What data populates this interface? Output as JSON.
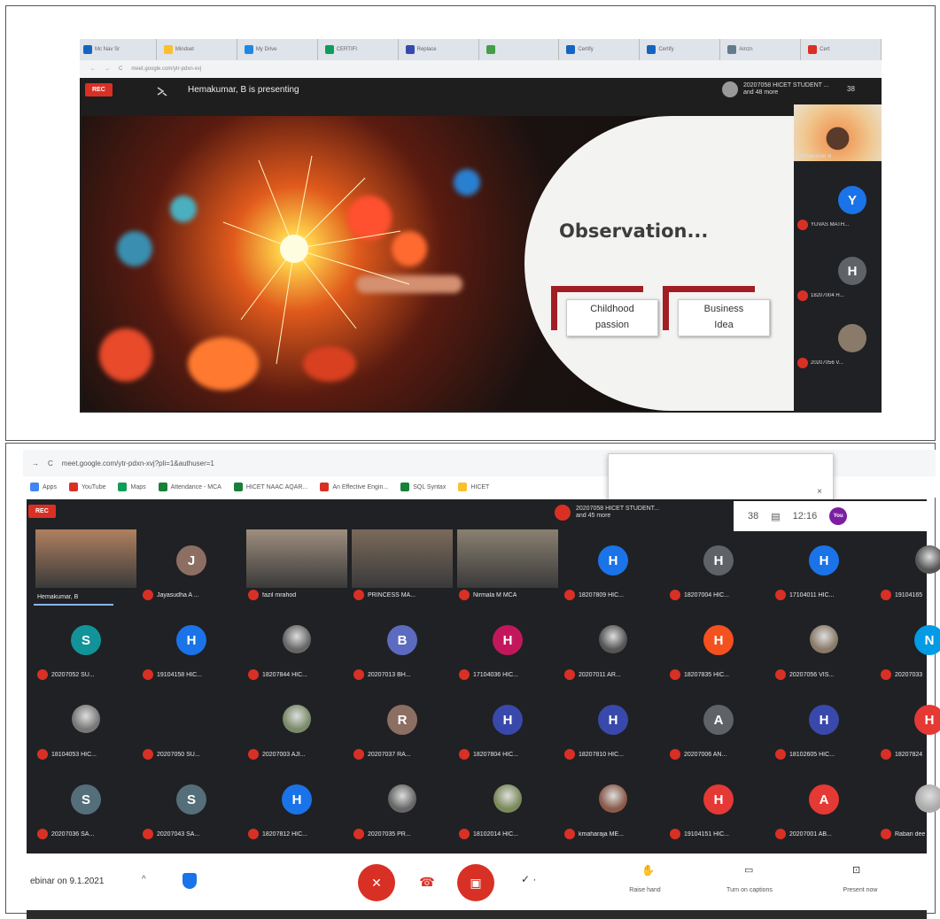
{
  "screen1": {
    "tabs": [
      "Mc Nav Sr",
      "Mindset",
      "My Drive",
      "CERTIFI",
      "Replace",
      "",
      "Certify",
      "Certify",
      "Amzn",
      "Cert"
    ],
    "url": "meet.google.com/ytr-pdxn-xvj",
    "rec_label": "REC",
    "presenting_text": "Hemakumar, B is presenting",
    "participants_line1": "20207058 HICET STUDENT ...",
    "participants_line2": "and 48 more",
    "people_count": "38",
    "slide": {
      "title": "Observation...",
      "box1": "Childhood\npassion",
      "box2": "Business\nIdea"
    },
    "side_tiles": [
      {
        "name": "Hemakumar B",
        "initial": "",
        "color": "#c0a080"
      },
      {
        "name": "YUVAS MATH...",
        "initial": "Y",
        "color": "#1a73e8"
      },
      {
        "name": "18207004 H...",
        "initial": "H",
        "color": "#5f6368"
      },
      {
        "name": "20207056 V...",
        "initial": "",
        "color": "#8a7a6a"
      }
    ]
  },
  "screen2": {
    "url": "meet.google.com/ytr-pdxn-xvj?pli=1&authuser=1",
    "bookmarks": [
      "Apps",
      "YouTube",
      "Maps",
      "Attendance - MCA",
      "HICET NAAC AQAR...",
      "An Effective Engin...",
      "SQL Syntax",
      "HICET"
    ],
    "header_participants_line1": "20207058 HICET STUDENT...",
    "header_participants_line2": "and 45 more",
    "rec_label": "REC",
    "people_count": "38",
    "time": "12:16",
    "you_label": "You",
    "meeting_name": "ebinar on 9.1.2021",
    "controls": {
      "raise_hand": "Raise hand",
      "captions": "Turn on captions",
      "present": "Present now"
    },
    "rows": [
      [
        {
          "name": "Hemakumar, B",
          "initial": "",
          "color": "#b08060",
          "photo": true
        },
        {
          "name": "Jayasudha A ...",
          "initial": "J",
          "color": "#8d6e63"
        },
        {
          "name": "fazil mrahod",
          "initial": "",
          "color": "#9e8e7e",
          "photo": true
        },
        {
          "name": "PRINCESS MA...",
          "initial": "",
          "color": "#7a6a5a",
          "photo": true
        },
        {
          "name": "Nirmala M MCA",
          "initial": "",
          "color": "#8a8070",
          "photo": true
        },
        {
          "name": "18207809 HIC...",
          "initial": "H",
          "color": "#1a73e8"
        },
        {
          "name": "18207004 HIC...",
          "initial": "H",
          "color": "#5f6368"
        },
        {
          "name": "17104011 HIC...",
          "initial": "H",
          "color": "#1a73e8"
        },
        {
          "name": "19104165",
          "initial": "",
          "color": "#555",
          "photo": true
        }
      ],
      [
        {
          "name": "20207052 SU...",
          "initial": "S",
          "color": "#12939a"
        },
        {
          "name": "19104158 HIC...",
          "initial": "H",
          "color": "#1a73e8"
        },
        {
          "name": "18207844 HIC...",
          "initial": "",
          "color": "#666",
          "photo": true
        },
        {
          "name": "20207013 BH...",
          "initial": "B",
          "color": "#5c6bc0"
        },
        {
          "name": "17104036 HIC...",
          "initial": "H",
          "color": "#c2185b"
        },
        {
          "name": "20207011 AR...",
          "initial": "",
          "color": "#555",
          "photo": true
        },
        {
          "name": "18207835 HIC...",
          "initial": "H",
          "color": "#f4511e"
        },
        {
          "name": "20207056 VIS...",
          "initial": "",
          "color": "#8a7a6a",
          "photo": true
        },
        {
          "name": "20207033",
          "initial": "N",
          "color": "#039be5"
        }
      ],
      [
        {
          "name": "18104053 HIC...",
          "initial": "",
          "color": "#777",
          "photo": true
        },
        {
          "name": "20207050 SU...",
          "initial": "",
          "color": "#202124",
          "photo": false
        },
        {
          "name": "20207003 AJI...",
          "initial": "",
          "color": "#7a8a6a",
          "photo": true
        },
        {
          "name": "20207037 RA...",
          "initial": "R",
          "color": "#8d6e63"
        },
        {
          "name": "18207804 HIC...",
          "initial": "H",
          "color": "#3949ab"
        },
        {
          "name": "18207810 HIC...",
          "initial": "H",
          "color": "#3949ab"
        },
        {
          "name": "20207006 AN...",
          "initial": "A",
          "color": "#5f6368"
        },
        {
          "name": "18102605 HIC...",
          "initial": "H",
          "color": "#3949ab"
        },
        {
          "name": "18207824",
          "initial": "H",
          "color": "#e53935"
        }
      ],
      [
        {
          "name": "20207036 SA...",
          "initial": "S",
          "color": "#546e7a"
        },
        {
          "name": "20207043 SA...",
          "initial": "S",
          "color": "#546e7a"
        },
        {
          "name": "18207812 HIC...",
          "initial": "H",
          "color": "#1a73e8"
        },
        {
          "name": "20207035 PR...",
          "initial": "",
          "color": "#666",
          "photo": true
        },
        {
          "name": "18102014 HIC...",
          "initial": "",
          "color": "#7a8a5a",
          "photo": true
        },
        {
          "name": "kmaharaja ME...",
          "initial": "",
          "color": "#8a5a4a",
          "photo": true
        },
        {
          "name": "19104151 HIC...",
          "initial": "H",
          "color": "#e53935"
        },
        {
          "name": "20207001 AB...",
          "initial": "A",
          "color": "#e53935"
        },
        {
          "name": "Rabari dee",
          "initial": "",
          "color": "#aaa",
          "photo": true
        }
      ]
    ]
  },
  "colors": {
    "red": "#d93025",
    "meet_bg": "#202124"
  }
}
